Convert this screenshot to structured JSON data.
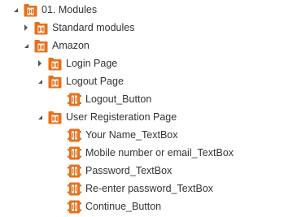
{
  "tree": {
    "root": {
      "label": "01. Modules",
      "icon": "folder-module-icon"
    },
    "standard": {
      "label": "Standard modules",
      "icon": "folder-module-icon"
    },
    "amazon": {
      "label": "Amazon",
      "icon": "folder-module-icon"
    },
    "login_page": {
      "label": "Login Page",
      "icon": "folder-module-icon"
    },
    "logout_page": {
      "label": "Logout Page",
      "icon": "folder-module-icon"
    },
    "logout_button": {
      "label": "Logout_Button",
      "icon": "module-icon"
    },
    "registration_page": {
      "label": "User Registeration Page",
      "icon": "folder-module-icon"
    },
    "your_name": {
      "label": "Your Name_TextBox",
      "icon": "module-icon"
    },
    "mobile_email": {
      "label": "Mobile number or email_TextBox",
      "icon": "module-icon"
    },
    "password": {
      "label": "Password_TextBox",
      "icon": "module-icon"
    },
    "reenter_password": {
      "label": "Re-enter password_TextBox",
      "icon": "module-icon"
    },
    "continue_button": {
      "label": "Continue_Button",
      "icon": "module-icon"
    }
  },
  "colors": {
    "icon_orange": "#E8701B",
    "icon_white": "#ffffff",
    "caret": "#555555",
    "text": "#333333"
  }
}
